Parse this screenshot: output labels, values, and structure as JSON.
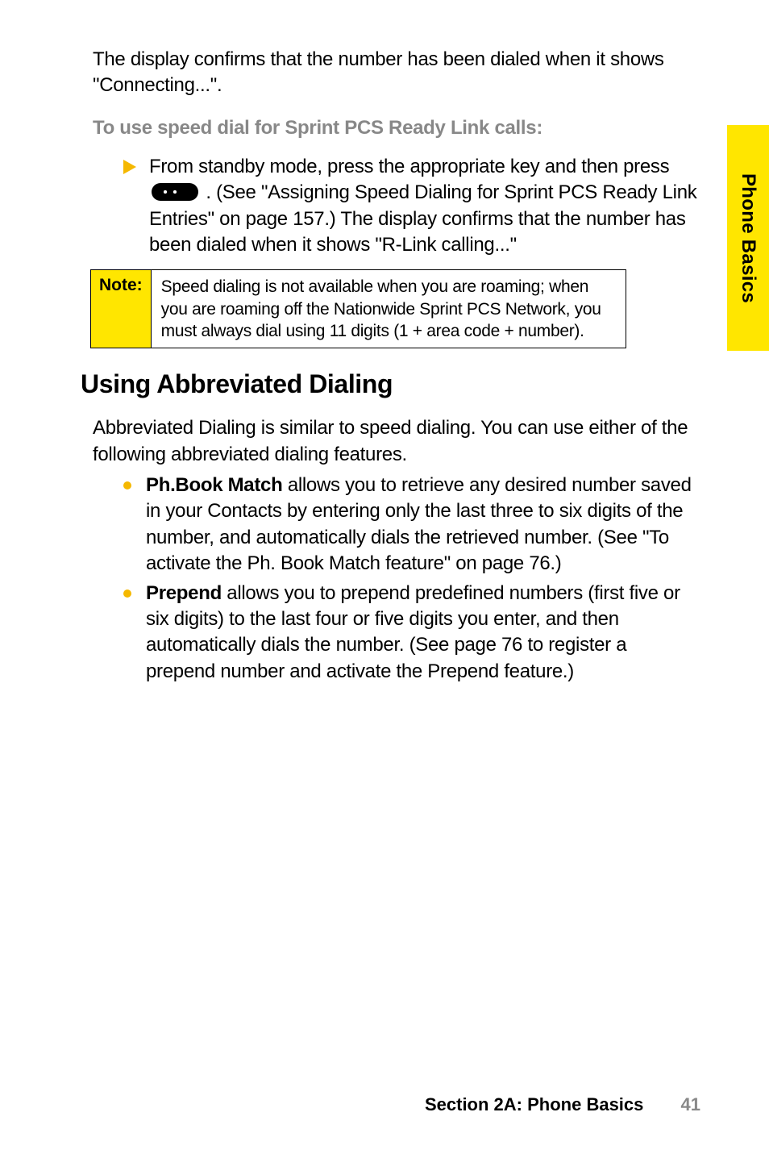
{
  "sideTab": "Phone Basics",
  "para1": "The display confirms that the number has been dialed when it shows \"Connecting...\".",
  "subHeading1": "To use speed dial for Sprint PCS Ready Link calls:",
  "step1_before": "From standby mode, press the appropriate key and then press ",
  "step1_after": " . (See \"Assigning Speed Dialing for Sprint PCS Ready Link Entries\" on page 157.) The display confirms that the number has been dialed when it shows \"R-Link calling...\"",
  "noteLabel": "Note:",
  "noteContent": "Speed dialing is not available when you are roaming; when you are roaming off the Nationwide Sprint PCS Network, you must always dial using 11 digits (1 + area code + number).",
  "h2": "Using Abbreviated Dialing",
  "para2": "Abbreviated Dialing is similar to speed dialing. You can use either of the following abbreviated dialing features.",
  "bullets": {
    "b1_label": "Ph.Book Match",
    "b1_text": " allows you to retrieve any desired number saved in your Contacts by entering only the last three to six digits of the number, and automatically dials the retrieved number. (See \"To activate the Ph. Book Match feature\" on page 76.)",
    "b2_label": "Prepend",
    "b2_text": " allows you to prepend predefined numbers (first five or six digits) to the last four or five digits you enter, and then automatically dials the number. (See page 76 to register a prepend number and activate the Prepend feature.)"
  },
  "footer": {
    "section": "Section 2A: Phone Basics",
    "page": "41"
  }
}
